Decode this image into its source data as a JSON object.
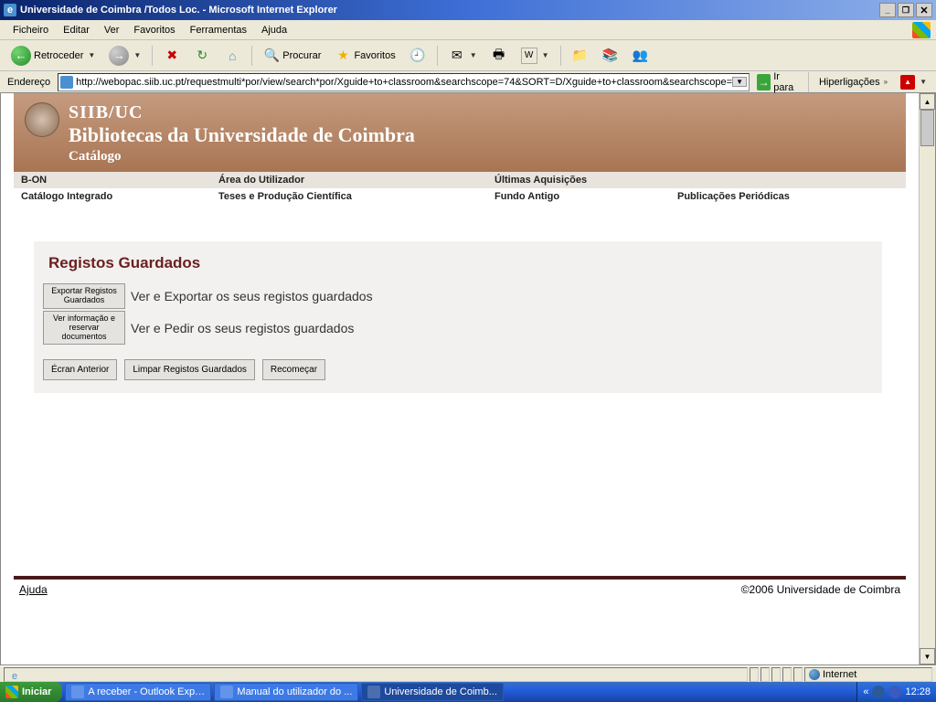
{
  "titlebar": {
    "title": "Universidade de Coimbra /Todos Loc. - Microsoft Internet Explorer"
  },
  "menu": {
    "items": [
      "Ficheiro",
      "Editar",
      "Ver",
      "Favoritos",
      "Ferramentas",
      "Ajuda"
    ]
  },
  "toolbar": {
    "back": "Retroceder",
    "search": "Procurar",
    "favorites": "Favoritos"
  },
  "addressbar": {
    "label": "Endereço",
    "url": "http://webopac.siib.uc.pt/requestmulti*por/view/search*por/Xguide+to+classroom&searchscope=74&SORT=D/Xguide+to+classroom&searchscope=",
    "go": "Ir para",
    "links": "Hiperligações"
  },
  "page": {
    "header": {
      "line1": "SIIB/UC",
      "line2": "Bibliotecas da Universidade de Coimbra",
      "line3": "Catálogo"
    },
    "nav": {
      "row1": [
        "B-ON",
        "Área do Utilizador",
        "Últimas Aquisições",
        ""
      ],
      "row2": [
        "Catálogo Integrado",
        "Teses e Produção Científica",
        "Fundo Antigo",
        "Publicações Periódicas"
      ]
    },
    "saved": {
      "title": "Registos Guardados",
      "export_btn": "Exportar Registos Guardados",
      "export_desc": "Ver e Exportar os seus registos guardados",
      "info_btn": "Ver informação e reservar documentos",
      "info_desc": "Ver e Pedir os seus registos guardados",
      "prev_btn": "Écran Anterior",
      "clear_btn": "Limpar Registos Guardados",
      "restart_btn": "Recomeçar"
    },
    "footer": {
      "help": "Ajuda",
      "copyright": "©2006 Universidade de Coimbra"
    }
  },
  "statusbar": {
    "zone": "Internet"
  },
  "taskbar": {
    "start": "Iniciar",
    "tasks": [
      "A receber - Outlook Expr...",
      "Manual do utilizador do ...",
      "Universidade de Coimb..."
    ],
    "clock": "12:28",
    "tray_chevron": "«"
  }
}
